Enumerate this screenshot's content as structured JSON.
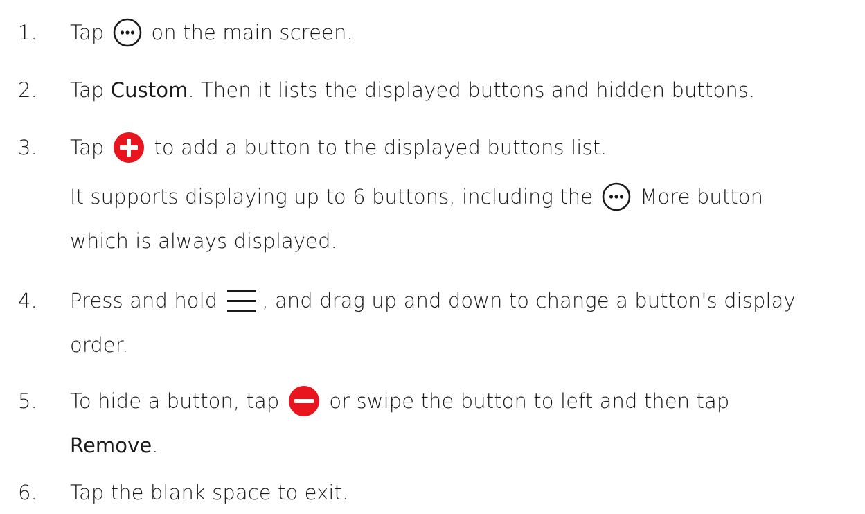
{
  "colors": {
    "text": "#1a1a1a",
    "accent_red": "#e8141e"
  },
  "steps": [
    {
      "num": "1.",
      "pre": "Tap",
      "icon": "more-circle-icon",
      "post": "on the main screen."
    },
    {
      "num": "2.",
      "pre": "Tap ",
      "bold": "Custom",
      "post": ". Then it lists the displayed buttons and hidden buttons."
    },
    {
      "num": "3.",
      "pre": "Tap",
      "icon": "add-circle-icon",
      "post": "to add a button to the displayed buttons list.",
      "extra_pre": "It supports displaying up to 6 buttons, including the",
      "extra_icon": "more-circle-icon",
      "extra_post": "More button",
      "extra_line2": "which is always displayed."
    },
    {
      "num": "4.",
      "pre": "Press and hold",
      "icon": "drag-handle-icon",
      "post": ", and drag up and down to change a button's display",
      "line2": "order."
    },
    {
      "num": "5.",
      "pre": "To hide a button, tap",
      "icon": "remove-circle-icon",
      "post": "or swipe the button to left and then tap",
      "line2_bold": "Remove",
      "line2_post": "."
    },
    {
      "num": "6.",
      "pre": "Tap the blank space to exit."
    }
  ]
}
